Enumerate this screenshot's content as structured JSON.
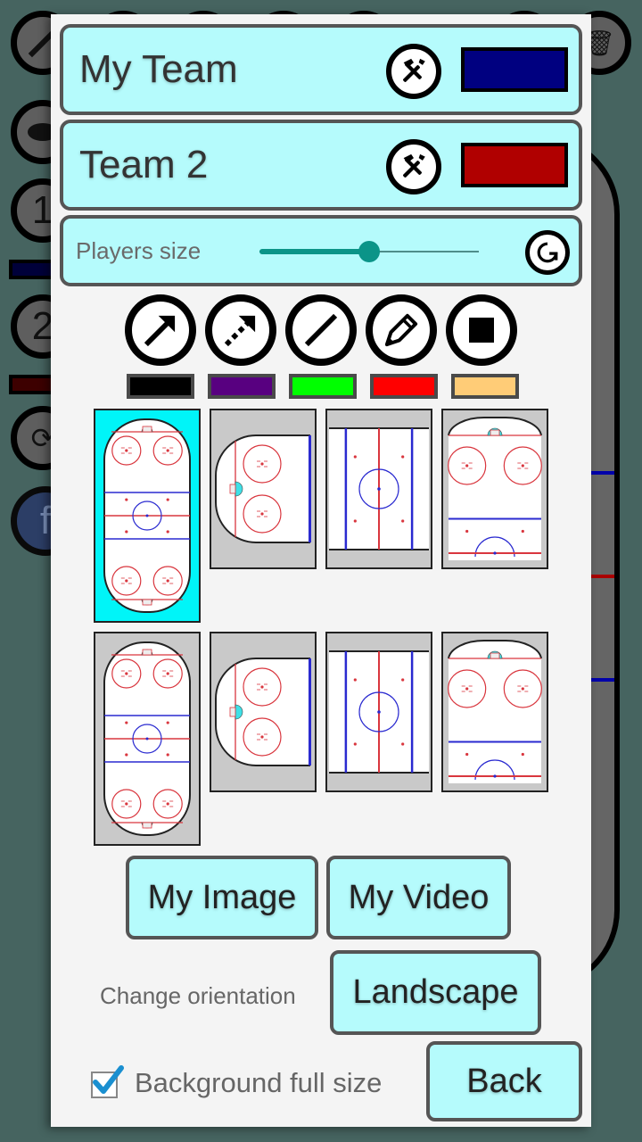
{
  "background_app": {
    "left_toolbar": [
      {
        "icon": "stick-icon",
        "label": ""
      },
      {
        "icon": "puck-icon",
        "label": ""
      },
      {
        "icon": "team-1-icon",
        "label": "1"
      },
      {
        "icon": "team-2-icon",
        "label": "2"
      },
      {
        "icon": "reset-icon",
        "label": ""
      },
      {
        "icon": "facebook-icon",
        "label": "f"
      }
    ],
    "team_strip_colors": [
      "#00003a",
      "#3d0000"
    ],
    "rink_line_colors": [
      "#0000aa",
      "#aa0000",
      "#0000aa"
    ]
  },
  "dialog": {
    "teams": [
      {
        "name": "My Team",
        "tools_icon": "hammer-screwdriver-icon",
        "color": "#000080"
      },
      {
        "name": "Team 2",
        "tools_icon": "hammer-screwdriver-icon",
        "color": "#b00000"
      }
    ],
    "players_size": {
      "label": "Players size",
      "value_fraction": 0.5,
      "reset_icon": "reset-icon"
    },
    "draw_tools": [
      {
        "id": "arrow",
        "icon": "arrow-icon"
      },
      {
        "id": "dashed-arrow",
        "icon": "dashed-arrow-icon"
      },
      {
        "id": "line",
        "icon": "line-icon"
      },
      {
        "id": "pencil",
        "icon": "pencil-icon"
      },
      {
        "id": "rectangle",
        "icon": "square-icon"
      }
    ],
    "draw_colors": [
      "#000000",
      "#580080",
      "#00ff00",
      "#ff0000",
      "#ffcc77"
    ],
    "rink_backgrounds": [
      {
        "id": "full-rink",
        "selected": true
      },
      {
        "id": "half-rink-left",
        "selected": false
      },
      {
        "id": "neutral-zone",
        "selected": false
      },
      {
        "id": "offensive-zone",
        "selected": false
      },
      {
        "id": "full-rink-alt",
        "selected": false
      },
      {
        "id": "half-rink-left-alt",
        "selected": false
      },
      {
        "id": "neutral-zone-alt",
        "selected": false
      },
      {
        "id": "offensive-zone-alt",
        "selected": false
      }
    ],
    "buttons": {
      "my_image": "My Image",
      "my_video": "My Video",
      "landscape": "Landscape",
      "back": "Back"
    },
    "change_orientation_label": "Change orientation",
    "background_full_size": {
      "label": "Background full size",
      "checked": true
    }
  }
}
